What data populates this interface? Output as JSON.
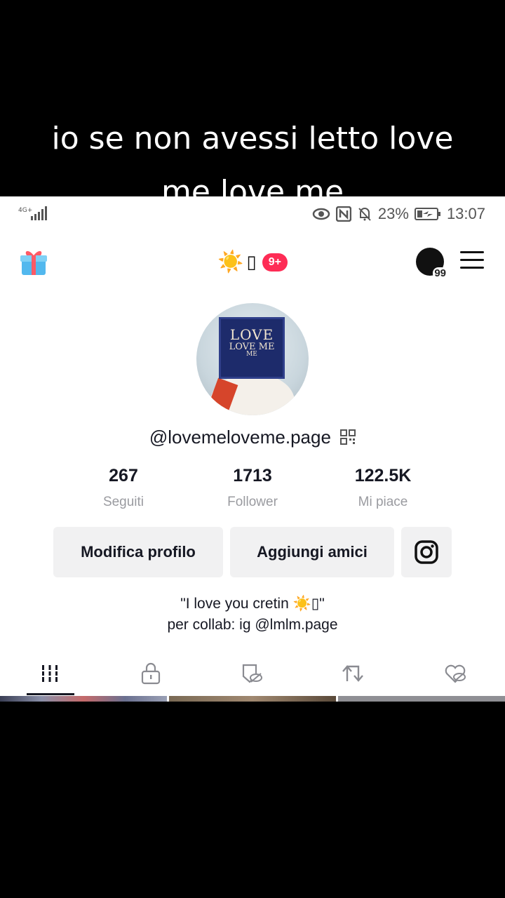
{
  "caption": {
    "line1": "io se non avessi letto love",
    "line2": "me love me"
  },
  "status_bar": {
    "network": "4G+",
    "battery": "23%",
    "time": "13:07"
  },
  "top_bar": {
    "name_emoji": "☀️",
    "name_tofu": "▯",
    "notification_badge": "9+",
    "creator_count": "99"
  },
  "profile": {
    "username": "@lovemeloveme.page",
    "avatar_text_1": "LOVE",
    "avatar_text_2": "LOVE ME",
    "avatar_text_3": "ME",
    "stats": [
      {
        "value": "267",
        "label": "Seguiti"
      },
      {
        "value": "1713",
        "label": "Follower"
      },
      {
        "value": "122.5K",
        "label": "Mi piace"
      }
    ],
    "buttons": {
      "edit": "Modifica profilo",
      "add_friends": "Aggiungi amici"
    },
    "bio_line1": "\"I love you cretin ☀️▯\"",
    "bio_line2": "per collab: ig @lmlm.page"
  },
  "tabs": [
    "videos-grid-icon",
    "lock-icon",
    "repost-hidden-icon",
    "repost-icon",
    "liked-hidden-icon"
  ],
  "colors": {
    "accent": "#fe2c55",
    "text": "#161823",
    "muted": "#9a9ba0"
  }
}
